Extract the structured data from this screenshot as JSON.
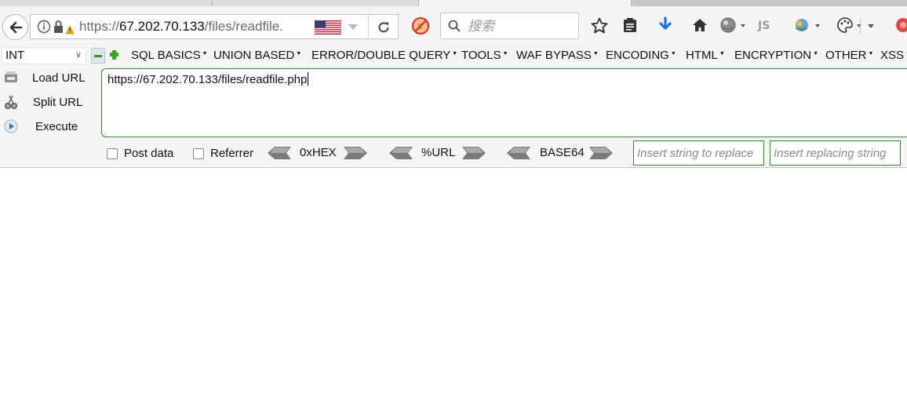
{
  "nav": {
    "url_prefix": "https://",
    "url_host": "67.202.70.133",
    "url_path": "/files/readfile.",
    "search_placeholder": "搜索"
  },
  "hackbar": {
    "select_value": "INT",
    "menus": [
      "SQL BASICS",
      "UNION BASED",
      "ERROR/DOUBLE QUERY",
      "TOOLS",
      "WAF BYPASS",
      "ENCODING",
      "HTML",
      "ENCRYPTION",
      "OTHER",
      "XSS"
    ],
    "load_url": "Load URL",
    "split_url": "Split URL",
    "execute": "Execute",
    "url_value": "https://67.202.70.133/files/readfile.php",
    "post_data": "Post data",
    "referrer": "Referrer",
    "hex": "0xHEX",
    "url_enc": "%URL",
    "base64": "BASE64",
    "replace_placeholder": "Insert string to replace",
    "replacing_placeholder": "Insert replacing string"
  },
  "colors": {
    "accent_green": "#2a8a2a",
    "download_blue": "#1a73e8"
  }
}
